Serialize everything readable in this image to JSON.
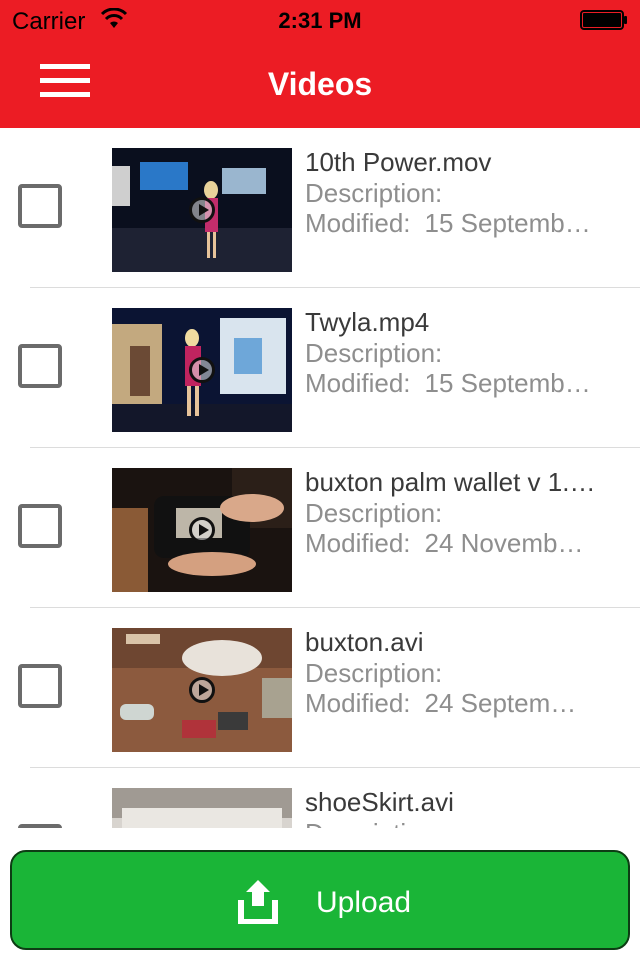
{
  "status_bar": {
    "carrier": "Carrier",
    "time": "2:31 PM"
  },
  "nav": {
    "title": "Videos",
    "menu_icon": "hamburger-menu-icon"
  },
  "videos": [
    {
      "title": "10th Power.mov",
      "description_label": "Description:",
      "modified_label": "Modified:",
      "modified_value": "15 Septemb…"
    },
    {
      "title": "Twyla.mp4",
      "description_label": "Description:",
      "modified_label": "Modified:",
      "modified_value": "15 Septemb…"
    },
    {
      "title": "buxton palm wallet v 1.…",
      "description_label": "Description:",
      "modified_label": "Modified:",
      "modified_value": "24 Novemb…"
    },
    {
      "title": "buxton.avi",
      "description_label": "Description:",
      "modified_label": "Modified:",
      "modified_value": "24 Septem…"
    },
    {
      "title": "shoeSkirt.avi",
      "description_label": "Description:",
      "modified_label": "",
      "modified_value": ""
    }
  ],
  "upload": {
    "label": "Upload",
    "icon": "upload-icon"
  },
  "colors": {
    "brand_red": "#ec1c24",
    "upload_green": "#1ab537"
  }
}
